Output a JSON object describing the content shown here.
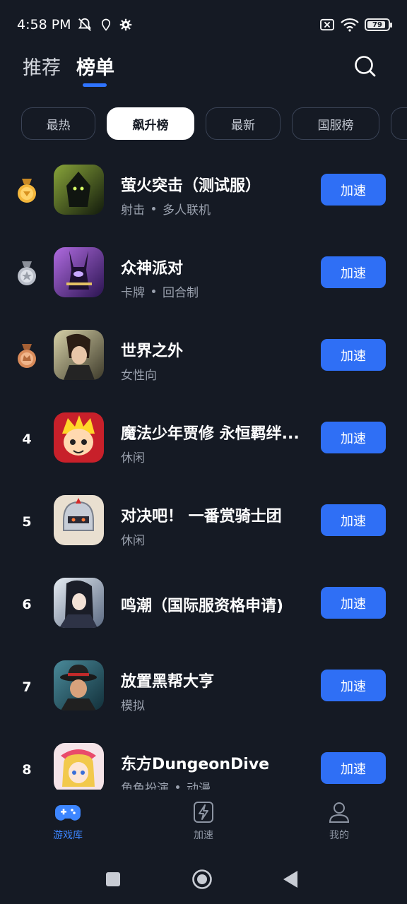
{
  "status": {
    "time": "4:58 PM",
    "battery": "79"
  },
  "top_nav": {
    "tabs": [
      {
        "label": "推荐",
        "active": false
      },
      {
        "label": "榜单",
        "active": true
      }
    ],
    "search_icon": "search-icon"
  },
  "chips": [
    {
      "label": "最热",
      "active": false
    },
    {
      "label": "飙升榜",
      "active": true
    },
    {
      "label": "最新",
      "active": false
    },
    {
      "label": "国服榜",
      "active": false
    }
  ],
  "rank_list": [
    {
      "rank": "1",
      "medal": "gold",
      "name": "萤火突击（测试服）",
      "tags": [
        "射击",
        "多人联机"
      ],
      "button": "加速"
    },
    {
      "rank": "2",
      "medal": "silver",
      "name": "众神派对",
      "tags": [
        "卡牌",
        "回合制"
      ],
      "button": "加速"
    },
    {
      "rank": "3",
      "medal": "bronze",
      "name": "世界之外",
      "tags": [
        "女性向"
      ],
      "button": "加速"
    },
    {
      "rank": "4",
      "medal": "",
      "name": "魔法少年贾修 永恒羁绊...",
      "tags": [
        "休闲"
      ],
      "button": "加速"
    },
    {
      "rank": "5",
      "medal": "",
      "name": "对决吧！ 一番赏骑士团",
      "tags": [
        "休闲"
      ],
      "button": "加速"
    },
    {
      "rank": "6",
      "medal": "",
      "name": "鸣潮（国际服资格申请)",
      "tags": [],
      "button": "加速"
    },
    {
      "rank": "7",
      "medal": "",
      "name": "放置黑帮大亨",
      "tags": [
        "模拟"
      ],
      "button": "加速"
    },
    {
      "rank": "8",
      "medal": "",
      "name": "东方DungeonDive",
      "tags": [
        "角色扮演",
        "动漫"
      ],
      "button": "加速"
    }
  ],
  "bottom_nav": {
    "items": [
      {
        "label": "游戏库",
        "icon": "gamepad-icon",
        "active": true
      },
      {
        "label": "加速",
        "icon": "lightning-icon",
        "active": false
      },
      {
        "label": "我的",
        "icon": "person-icon",
        "active": false
      }
    ]
  },
  "colors": {
    "background": "#151a24",
    "accent": "#2f6ff5",
    "active_nav": "#3d86ff"
  }
}
